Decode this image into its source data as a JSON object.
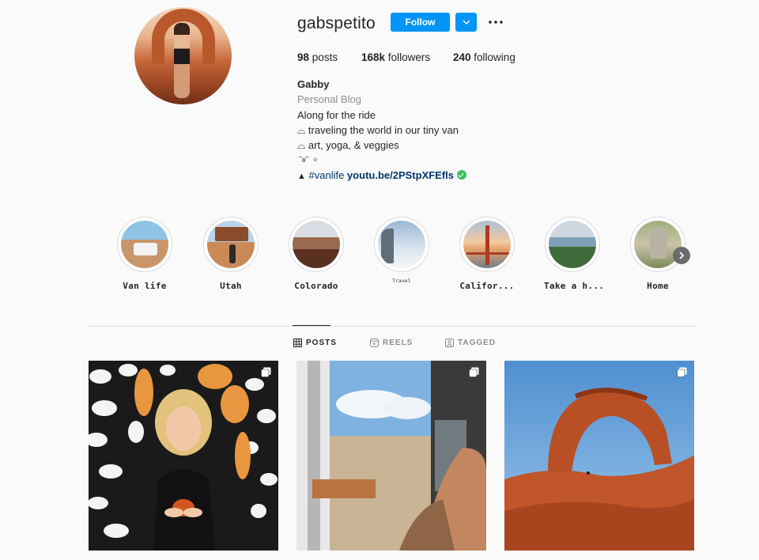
{
  "profile": {
    "username": "gabspetito",
    "follow_label": "Follow",
    "dropdown_icon": "chevron-down-icon",
    "more_icon": "ellipsis-icon",
    "accent_color": "#0095f6"
  },
  "stats": {
    "posts_count": "98",
    "posts_label": "posts",
    "followers_count": "168k",
    "followers_label": "followers",
    "following_count": "240",
    "following_label": "following"
  },
  "bio": {
    "name": "Gabby",
    "category": "Personal Blog",
    "line1": "Along for the ride",
    "line2": "⌓ traveling the world in our tiny van",
    "line3": "⌓ art, yoga, & veggies",
    "line4": "˙˚ʚ˚˙ ✧",
    "line5_prefix": "▲",
    "hashtag": "#vanlife",
    "link": "youtu.be/2PStpXFEfls"
  },
  "highlights": [
    {
      "label": "Van life"
    },
    {
      "label": "Utah"
    },
    {
      "label": "Colorado"
    },
    {
      "label": "Travel"
    },
    {
      "label": "Califor..."
    },
    {
      "label": "Take a h..."
    },
    {
      "label": "Home"
    }
  ],
  "tabs": [
    {
      "label": "POSTS",
      "icon": "grid-icon",
      "active": true
    },
    {
      "label": "REELS",
      "icon": "reels-icon",
      "active": false
    },
    {
      "label": "TAGGED",
      "icon": "tagged-icon",
      "active": false
    }
  ]
}
